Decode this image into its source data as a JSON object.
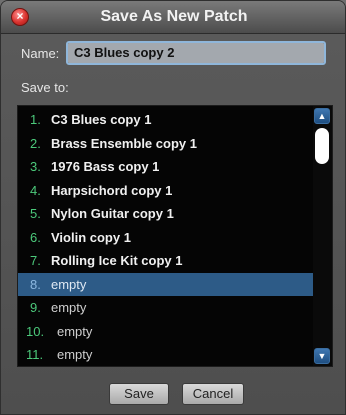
{
  "window": {
    "title": "Save As New Patch",
    "close_symbol": "×"
  },
  "name_field": {
    "label": "Name:",
    "value": "C3 Blues copy 2"
  },
  "save_to": {
    "label": "Save to:",
    "selected_index": 7,
    "items": [
      {
        "num": "1.",
        "label": "C3 Blues copy 1",
        "empty": false
      },
      {
        "num": "2.",
        "label": "Brass Ensemble copy 1",
        "empty": false
      },
      {
        "num": "3.",
        "label": "1976 Bass copy 1",
        "empty": false
      },
      {
        "num": "4.",
        "label": "Harpsichord copy 1",
        "empty": false
      },
      {
        "num": "5.",
        "label": "Nylon Guitar copy 1",
        "empty": false
      },
      {
        "num": "6.",
        "label": "Violin copy 1",
        "empty": false
      },
      {
        "num": "7.",
        "label": "Rolling Ice Kit copy 1",
        "empty": false
      },
      {
        "num": "8.",
        "label": "empty",
        "empty": true
      },
      {
        "num": "9.",
        "label": "empty",
        "empty": true
      },
      {
        "num": "10.",
        "label": "empty",
        "empty": true
      },
      {
        "num": "11.",
        "label": "empty",
        "empty": true
      }
    ]
  },
  "scroll": {
    "up_icon": "chevron-up-icon",
    "down_icon": "chevron-down-icon"
  },
  "buttons": {
    "save": "Save",
    "cancel": "Cancel"
  },
  "colors": {
    "selection": "#2d5b87",
    "number": "#4cc97b"
  }
}
